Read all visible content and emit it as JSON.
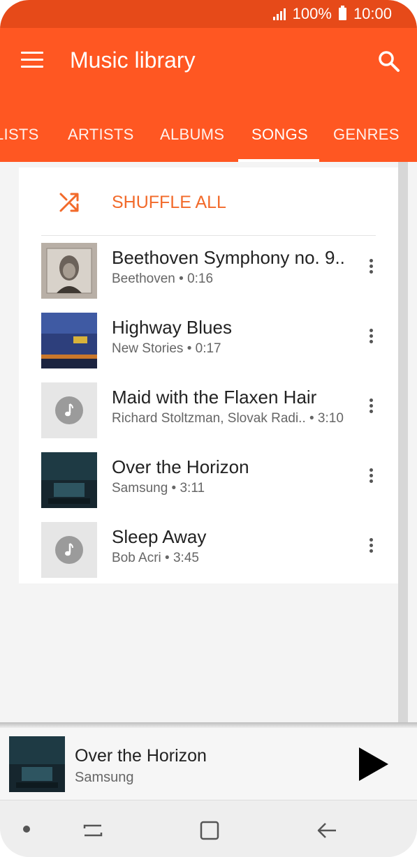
{
  "status_bar": {
    "battery": "100%",
    "time": "10:00"
  },
  "app_bar": {
    "title": "Music library"
  },
  "tabs": [
    {
      "label": "LISTS"
    },
    {
      "label": "ARTISTS"
    },
    {
      "label": "ALBUMS"
    },
    {
      "label": "SONGS",
      "selected": true
    },
    {
      "label": "GENRES"
    }
  ],
  "shuffle": {
    "label": "SHUFFLE ALL"
  },
  "songs": [
    {
      "title": "Beethoven Symphony no. 9..",
      "subtitle": "Beethoven • 0:16",
      "art": "beethoven-portrait"
    },
    {
      "title": "Highway Blues",
      "subtitle": "New Stories • 0:17",
      "art": "blue-sky-album"
    },
    {
      "title": "Maid with the Flaxen Hair",
      "subtitle": "Richard Stoltzman, Slovak Radi..  • 3:10",
      "art": "music-note-placeholder"
    },
    {
      "title": "Over the Horizon",
      "subtitle": "Samsung • 3:11",
      "art": "over-the-horizon-album"
    },
    {
      "title": "Sleep Away",
      "subtitle": "Bob Acri • 3:45",
      "art": "music-note-placeholder"
    }
  ],
  "now_playing": {
    "title": "Over the Horizon",
    "artist": "Samsung"
  },
  "colors": {
    "status_bar": "#E64A19",
    "app_bar": "#FF5722",
    "accent": "#F26A2A"
  }
}
